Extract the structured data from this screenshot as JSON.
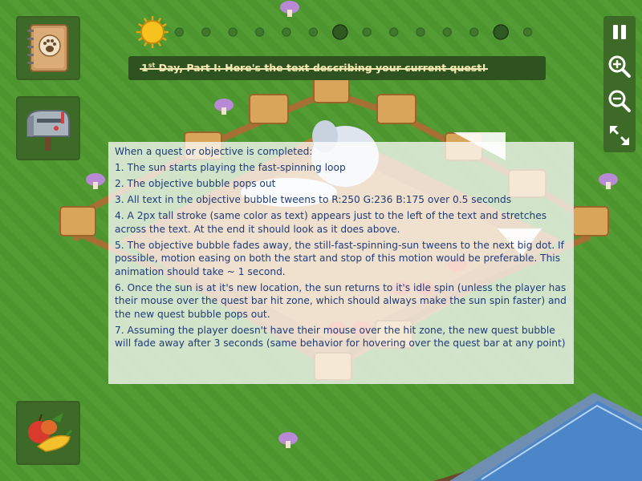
{
  "quest": {
    "title_part_prefix": "1",
    "title_part_super": "st",
    "title_text": " Day, Part I: Here's the text describing your current quest!"
  },
  "instructions": {
    "heading": "When a quest or objective is completed:",
    "steps": [
      "1. The sun starts playing the fast-spinning loop",
      "2. The objective bubble pops out",
      "3. All text in the objective bubble tweens to R:250 G:236 B:175 over 0.5 seconds",
      "4. A 2px tall stroke (same color as text) appears just to the left of the text and stretches across the text. At the end it should look as it does above.",
      "5. The objective bubble fades away, the still-fast-spinning-sun tweens to the next big dot. If possible, motion easing on both the start and stop of this motion would be preferable. This animation should take ~ 1 second.",
      "6. Once the sun is at it's new location, the sun returns to it's idle spin (unless the player has their mouse over the quest bar hit zone, which should always make the sun spin faster) and the new quest bubble pops out.",
      "7. Assuming the player doesn't have their mouse over the hit zone, the new quest bubble will fade away after 3 seconds (same behavior for hovering over the quest bar at any point)"
    ]
  },
  "progress": {
    "small_dots": 12,
    "big_dot_indexes": [
      7,
      13
    ],
    "current_index": 0
  },
  "icons": {
    "journal": "journal-paw-icon",
    "mailbox": "mailbox-icon",
    "produce": "produce-basket-icon",
    "pause": "pause-icon",
    "zoom_in": "zoom-in-icon",
    "zoom_out": "zoom-out-icon",
    "fullscreen": "fullscreen-icon"
  },
  "colors": {
    "grass": "#4f9a2f",
    "panel": "#3d6a26",
    "quest_bar": "#2f5221",
    "quest_text_completed": "#f5e8b0",
    "instruction_text": "#1f3b78",
    "sun": "#f7c21e"
  }
}
